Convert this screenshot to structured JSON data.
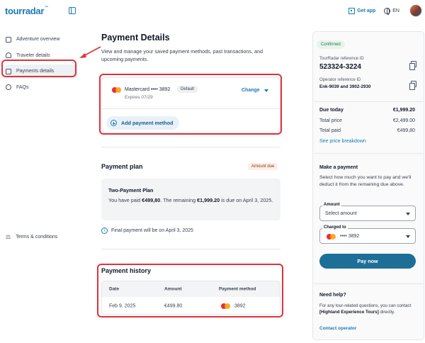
{
  "header": {
    "logo": "tourradar",
    "logo_tm": "™",
    "get_app": "Get app",
    "language": "EN"
  },
  "sidebar": {
    "items": [
      {
        "label": "Adventure overview",
        "icon": "clipboard-icon"
      },
      {
        "label": "Traveler details",
        "icon": "people-icon"
      },
      {
        "label": "Payments details",
        "icon": "wallet-icon"
      },
      {
        "label": "FAQs",
        "icon": "question-icon"
      }
    ],
    "terms": "Terms & conditions"
  },
  "main": {
    "title": "Payment Details",
    "subtitle": "View and manage your saved payment methods, past transactions, and upcoming payments.",
    "card": {
      "brand": "Mastercard",
      "masked": "•••• 3892",
      "default_badge": "Default",
      "expires": "Expires 07/29",
      "change": "Change"
    },
    "add_payment": "Add payment method",
    "plan": {
      "section_title": "Payment plan",
      "badge": "Amount due",
      "name": "Two-Payment Plan",
      "text_prefix": "You have paid ",
      "paid": "€499,80",
      "text_mid": ". The remaining ",
      "remaining": "€1,999.20",
      "text_suffix": " is due on April 3, 2025.",
      "final_note": "Final payment will be on April 3, 2025"
    },
    "history": {
      "title": "Payment history",
      "columns": [
        "Date",
        "Amount",
        "Payment method"
      ],
      "rows": [
        {
          "date": "Feb 9, 2025",
          "amount": "€499.80",
          "method": "3892"
        }
      ]
    }
  },
  "right": {
    "status": "Confirmed",
    "ref_label": "TourRadar reference ID",
    "ref_id": "523324-3224",
    "op_ref_label": "Operator reference ID",
    "op_ref_id": "Enk-9039 and 3902-2930",
    "summary": [
      {
        "label": "Due today",
        "value": "€1,999.20"
      },
      {
        "label": "Total price",
        "value": "€2,499.00"
      },
      {
        "label": "Total paid",
        "value": "€499,80"
      }
    ],
    "breakdown_link": "See price breakdown",
    "make_payment": {
      "title": "Make a payment",
      "desc": "Select how much you want to pay and we'll deduct it from the remaining due above.",
      "amount_label": "Amount",
      "amount_value": "Select amount",
      "charged_label": "Charged to",
      "charged_value": "•••• 3892",
      "pay_now": "Pay now"
    },
    "help": {
      "title": "Need help?",
      "text_prefix": "For any tour-related questions, you can contact ",
      "operator": "[Highland Experience Tours]",
      "text_suffix": " directly.",
      "contact_link": "Contact operator"
    }
  },
  "colors": {
    "accent": "#1a7ab8",
    "highlight": "#e0323a",
    "pay_button": "#1d6f97"
  }
}
